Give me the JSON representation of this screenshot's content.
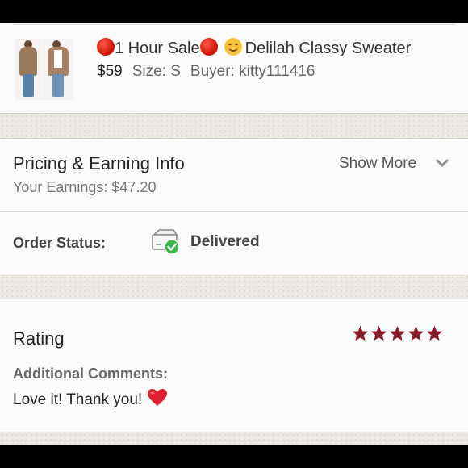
{
  "item": {
    "title_prefix": "1 Hour Sale",
    "title_suffix": "Delilah Classy Sweater",
    "price": "$59",
    "size": "Size: S",
    "buyer": "Buyer: kitty111416"
  },
  "pricing": {
    "title": "Pricing & Earning Info",
    "earnings": "Your Earnings: $47.20",
    "show_more": "Show More"
  },
  "order_status": {
    "label": "Order Status:",
    "value": "Delivered"
  },
  "rating": {
    "title": "Rating",
    "stars": 5,
    "max_stars": 5,
    "comments_label": "Additional Comments:",
    "comments_text": "Love it! Thank you!"
  },
  "colors": {
    "star": "#8b1a2b",
    "check_green": "#3cb54a",
    "sale_dot_red": "#d4170c",
    "heart_red": "#e0202e"
  },
  "icons": [
    "red-circle-emoji",
    "smiling-face-emoji",
    "chevron-down-icon",
    "delivered-box-icon",
    "star-icon",
    "red-heart-emoji"
  ]
}
